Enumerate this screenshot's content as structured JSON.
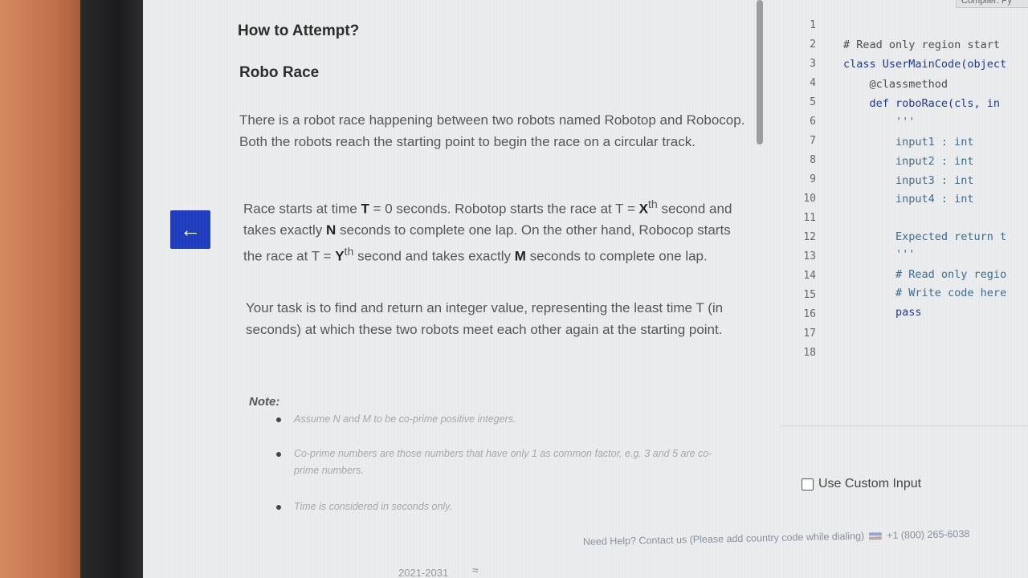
{
  "problem": {
    "heading": "How to Attempt?",
    "title": "Robo Race",
    "para1": "There is a robot race happening between two robots named Robotop and Robocop. Both the robots reach the starting point to begin the race on a circular track.",
    "para2": {
      "a": "Race starts at time ",
      "T": "T",
      "b": " = 0 seconds. Robotop starts the race at T = ",
      "X": "X",
      "xsup": "th",
      "c": " second and takes exactly ",
      "N": "N",
      "d": " seconds to complete one lap. On the other hand, Robocop starts the race at T = ",
      "Y": "Y",
      "ysup": "th",
      "e": " second and takes exactly ",
      "M": "M",
      "f": " seconds to complete one lap."
    },
    "para3": "Your task is to find and return an integer value, representing the least time T (in seconds) at which these two robots meet each other again at the starting point.",
    "note_label": "Note:",
    "notes": [
      "Assume N and M to be co-prime positive integers.",
      "Co-prime numbers are those numbers that have only 1 as common factor, e.g. 3 and 5 are co-prime numbers.",
      "Time is considered in seconds only."
    ],
    "back_icon": "arrow-left-icon"
  },
  "editor": {
    "compiler_label": "Compiler: Py",
    "line_numbers": [
      "1",
      "2",
      "3",
      "4",
      "5",
      "6",
      "7",
      "8",
      "9",
      "10",
      "11",
      "12",
      "13",
      "14",
      "15",
      "16",
      "17",
      "18"
    ],
    "lines": [
      "# Read only region start",
      "class UserMainCode(object",
      "    @classmethod",
      "    def roboRace(cls, in",
      "        '''",
      "        input1 : int",
      "        input2 : int",
      "        input3 : int",
      "        input4 : int",
      "        Expected return t",
      "        '''",
      "        # Read only regio",
      "        # Write code here",
      "        pass"
    ],
    "custom_input_label": "Use Custom Input"
  },
  "footer": {
    "year": "2021-2031",
    "help_text": "Need Help? Contact us (Please add country code while dialing)",
    "phone": "+1 (800) 265-6038"
  }
}
